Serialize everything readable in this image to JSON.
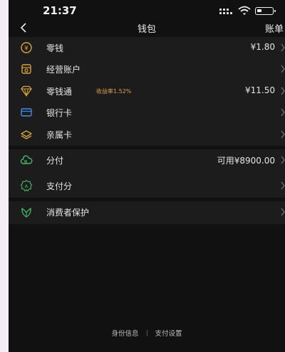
{
  "status": {
    "time": "21:37"
  },
  "nav": {
    "title": "钱包",
    "right": "账单"
  },
  "wallet_items": [
    {
      "label": "零钱",
      "value": "¥1.80",
      "icon": "coin-icon"
    },
    {
      "label": "经营账户",
      "value": "",
      "icon": "store-icon"
    },
    {
      "label": "零钱通",
      "badge": "收益率1.52%",
      "value": "¥11.50",
      "icon": "diamond-icon"
    },
    {
      "label": "银行卡",
      "value": "",
      "icon": "bank-card-icon"
    },
    {
      "label": "亲属卡",
      "value": "",
      "icon": "family-card-icon"
    }
  ],
  "credit_items": [
    {
      "label": "分付",
      "value": "可用¥8900.00",
      "icon": "cloud-icon"
    },
    {
      "label": "支付分",
      "value": "",
      "icon": "score-badge-icon"
    }
  ],
  "protect_items": [
    {
      "label": "消费者保护",
      "value": "",
      "icon": "shield-leaf-icon"
    }
  ],
  "footer": {
    "identity": "身份信息",
    "settings": "支付设置"
  },
  "colors": {
    "gold": "#d9a441",
    "blue": "#4a8be8",
    "green": "#49b869",
    "badge": "#e0a052",
    "background": "#111111",
    "panel": "#1c1c1c"
  }
}
